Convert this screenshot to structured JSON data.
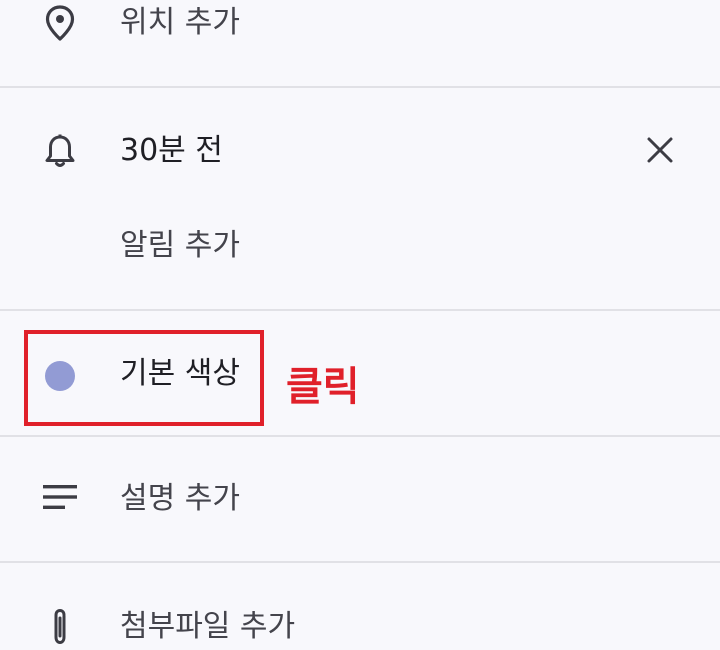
{
  "location": {
    "label": "위치 추가",
    "icon": "location-pin-icon"
  },
  "notification": {
    "time_label": "30분 전",
    "icon": "bell-icon",
    "remove_icon": "close-icon",
    "add_label": "알림 추가"
  },
  "color": {
    "label": "기본 색상",
    "swatch_color": "#929bd4"
  },
  "annotation": {
    "text": "클릭",
    "color": "#e0202a"
  },
  "description": {
    "label": "설명 추가",
    "icon": "notes-icon"
  },
  "attachment": {
    "label": "첨부파일 추가",
    "icon": "paperclip-icon"
  }
}
